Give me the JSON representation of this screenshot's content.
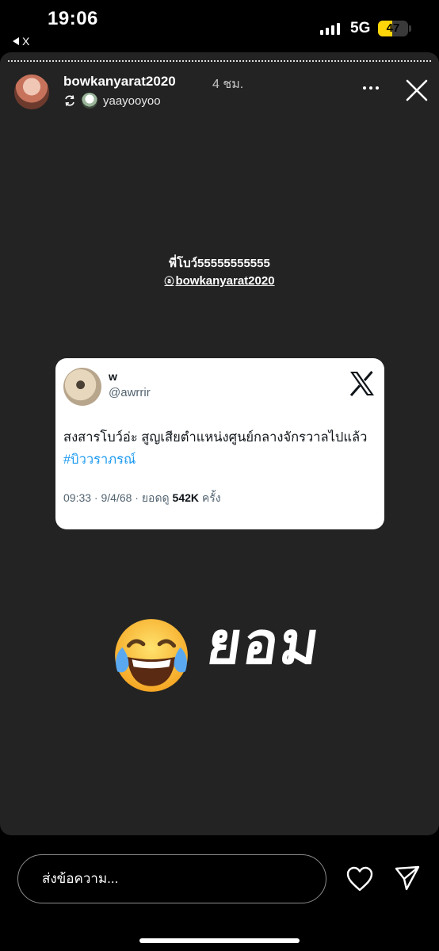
{
  "status_bar": {
    "time": "19:06",
    "back_label": "X",
    "network": "5G",
    "battery_level": 47,
    "battery_text": "47",
    "battery_color": "#ffd60a"
  },
  "story": {
    "username": "bowkanyarat2020",
    "post_time": "4 ชม.",
    "reposter_name": "yaayooyoo",
    "caption_line1": "พี่โบว์55555555555",
    "mention": "bowkanyarat2020",
    "sticker_text": "ยอม",
    "icons": [
      "repost-icon",
      "more-icon",
      "close-icon",
      "face-with-tears-of-joy-emoji"
    ]
  },
  "tweet": {
    "name": "w",
    "handle": "@awrrir",
    "text": "สงสารโบว์อ่ะ สูญเสียตำแหน่งศูนย์กลางจักรวาลไปแล้ว ",
    "hashtag": "#บิววราภรณ์",
    "time_date": "09:33 · 9/4/68 · ยอดดู ",
    "views": "542K",
    "views_suffix": " ครั้ง",
    "hashtag_color": "#1d9bf0",
    "logo": "x-logo"
  },
  "reply_bar": {
    "placeholder": "ส่งข้อความ...",
    "icons": [
      "heart-icon",
      "send-icon"
    ]
  }
}
